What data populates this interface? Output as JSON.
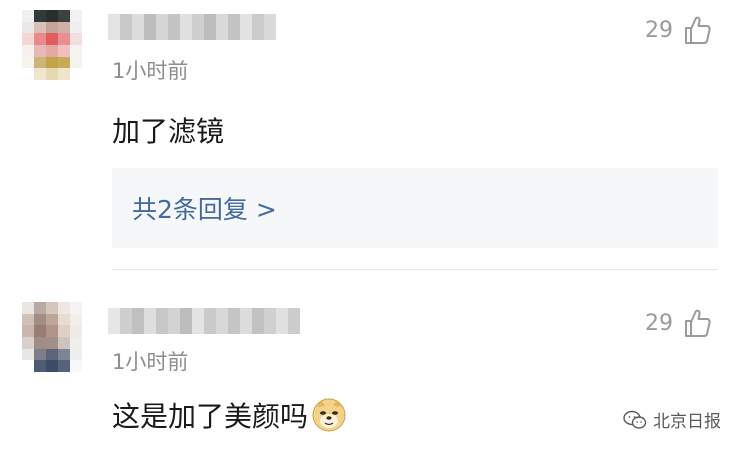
{
  "comments": [
    {
      "time": "1小时前",
      "likes": "29",
      "content": "加了滤镜",
      "replies_label": "共2条回复 >",
      "avatar_pixels": [
        "#f0f0f0",
        "#2e3b3a",
        "#2b2f2d",
        "#3b4240",
        "#f2f2f2",
        "#e8e8e8",
        "#d9bfb5",
        "#c7a49a",
        "#cfb0a8",
        "#efefef",
        "#f4d6d6",
        "#e98b8c",
        "#e35c60",
        "#e98f90",
        "#f2dede",
        "#f6f1f1",
        "#eab7b4",
        "#e4a9a2",
        "#eec1bf",
        "#f5f2f2",
        "#f7f4ee",
        "#cdb57a",
        "#c2a347",
        "#c6ab5b",
        "#f5f3ee",
        "#ffffff",
        "#efe6cf",
        "#e6d8b1",
        "#efe5cd",
        "#ffffff"
      ],
      "username_pixels": [
        "#e4e4e4",
        "#c9c9c9",
        "#dcdcdc",
        "#bdbdbd",
        "#d6d6d6",
        "#c4c4c4",
        "#e0e0e0",
        "#cfcfcf",
        "#bcbcbc",
        "#d9d9d9",
        "#c3c3c3",
        "#e2e2e2",
        "#cbcbcb",
        "#dadada"
      ]
    },
    {
      "time": "1小时前",
      "likes": "29",
      "content": "这是加了美颜吗",
      "emoji": "doge-emoji",
      "avatar_pixels": [
        "#e9e6e4",
        "#b9a9a2",
        "#d5c6bd",
        "#efe8e2",
        "#f6f4f2",
        "#cfc0b8",
        "#a48d85",
        "#bda59a",
        "#e8ddd4",
        "#f2eeea",
        "#c9b7ae",
        "#9a7d73",
        "#b0948a",
        "#ddd0c8",
        "#eeebe7",
        "#d8d0cc",
        "#9e8c86",
        "#a48f88",
        "#cdc4c0",
        "#f1efee",
        "#e8e6e6",
        "#7c7d88",
        "#5b6479",
        "#7e8491",
        "#efeeee",
        "#ffffff",
        "#4e5b74",
        "#3f4c67",
        "#56637a",
        "#f8f8f8"
      ],
      "username_pixels": [
        "#e6e6e6",
        "#cfcfcf",
        "#c0c0c0",
        "#dedede",
        "#c7c7c7",
        "#d3d3d3",
        "#bdbdbd",
        "#e3e3e3",
        "#cacaca",
        "#d8d8d8",
        "#c5c5c5",
        "#dcdcdc",
        "#c2c2c2",
        "#d0d0d0",
        "#e1e1e1",
        "#cccccc"
      ]
    }
  ],
  "watermark": {
    "label": "北京日报",
    "icon": "wechat-icon"
  },
  "colors": {
    "reply_link": "#44699c",
    "reply_bg": "#f6f7f9",
    "meta_text": "#8e8e8e"
  }
}
